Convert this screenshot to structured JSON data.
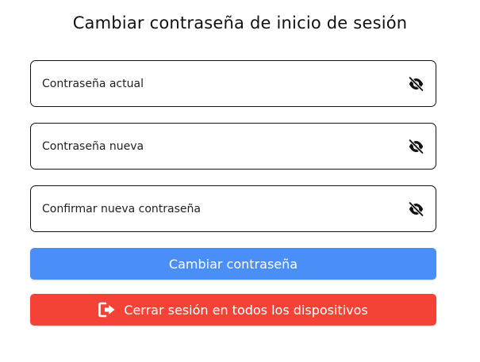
{
  "page": {
    "title": "Cambiar contraseña de inicio de sesión"
  },
  "form": {
    "current_password": {
      "placeholder": "Contraseña actual",
      "value": "",
      "toggle_icon": "eye-slash-icon"
    },
    "new_password": {
      "placeholder": "Contraseña nueva",
      "value": "",
      "toggle_icon": "eye-slash-icon"
    },
    "confirm_password": {
      "placeholder": "Confirmar nueva contraseña",
      "value": "",
      "toggle_icon": "eye-slash-icon"
    }
  },
  "actions": {
    "change_label": "Cambiar contraseña",
    "logout_all_label": "Cerrar sesión en todos los dispositivos",
    "logout_icon": "sign-out-icon"
  },
  "colors": {
    "primary": "#4a8ff7",
    "danger": "#f44336",
    "border": "#111111"
  }
}
